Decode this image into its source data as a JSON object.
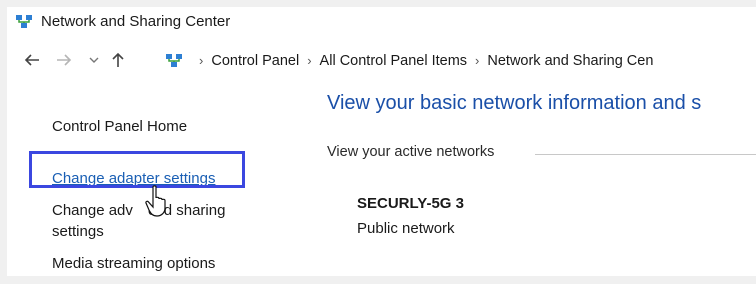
{
  "window": {
    "title": "Network and Sharing Center"
  },
  "navigation": {
    "back_icon": "arrow-left-icon",
    "forward_icon": "arrow-right-icon",
    "recent_icon": "chevron-down-icon",
    "up_icon": "arrow-up-icon",
    "breadcrumbs": [
      "Control Panel",
      "All Control Panel Items",
      "Network and Sharing Cen"
    ]
  },
  "sidebar": {
    "items": [
      {
        "label": "Control Panel Home"
      },
      {
        "label": "Change adapter settings"
      },
      {
        "label_line1": "Change adv ced sharing",
        "label_line2": "settings"
      },
      {
        "label": "Media streaming options"
      }
    ]
  },
  "main": {
    "title": "View your basic network information and s",
    "active_networks_label": "View your active networks",
    "network": {
      "name": "SECURLY-5G 3",
      "type": "Public network"
    }
  },
  "colors": {
    "link_blue": "#1a5fb4",
    "title_blue": "#1a4fa8",
    "highlight": "#3b47e0"
  }
}
